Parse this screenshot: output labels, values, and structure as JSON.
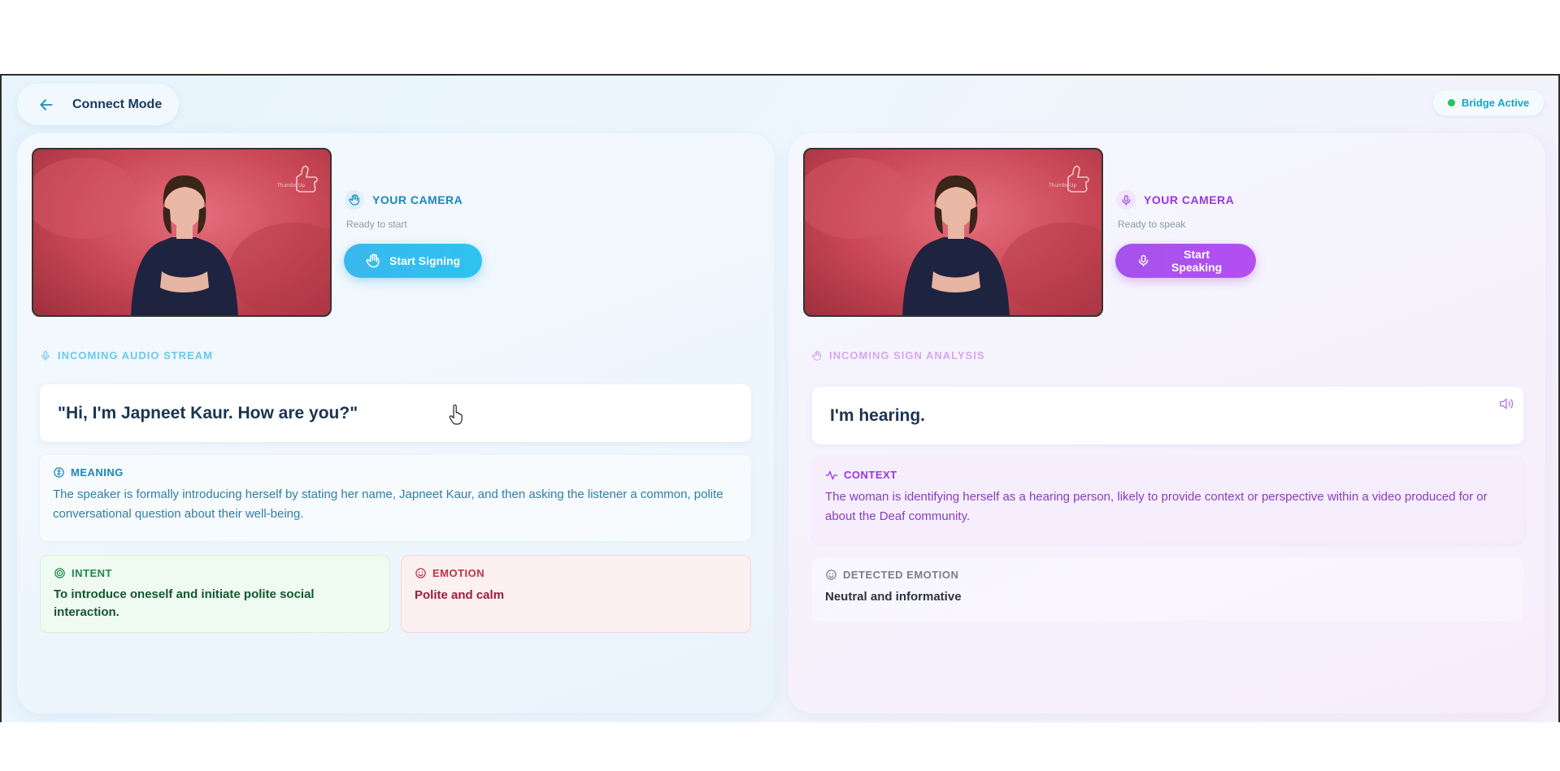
{
  "header": {
    "title": "Connect Mode",
    "status": "Bridge Active"
  },
  "left": {
    "camera_label": "YOUR CAMERA",
    "camera_status": "Ready to start",
    "button": "Start Signing",
    "stream_label": "INCOMING AUDIO STREAM",
    "quote": "\"Hi, I'm Japneet Kaur. How are you?\"",
    "meaning": {
      "label": "MEANING",
      "text": "The speaker is formally introducing herself by stating her name, Japneet Kaur, and then asking the listener a common, polite conversational question about their well-being."
    },
    "intent": {
      "label": "INTENT",
      "text": "To introduce oneself and initiate polite social interaction."
    },
    "emotion": {
      "label": "EMOTION",
      "text": "Polite and calm"
    }
  },
  "right": {
    "camera_label": "YOUR CAMERA",
    "camera_status": "Ready to speak",
    "button": "Start Speaking",
    "stream_label": "INCOMING SIGN ANALYSIS",
    "quote": "I'm hearing.",
    "context": {
      "label": "CONTEXT",
      "text": "The woman is identifying herself as a hearing person, likely to provide context or perspective within a video produced for or about the Deaf community."
    },
    "detected_emotion": {
      "label": "DETECTED EMOTION",
      "text": "Neutral and informative"
    }
  },
  "colors": {
    "accent_blue": "#2eb6ec",
    "accent_purple": "#a94ff0",
    "status_green": "#22c55e",
    "text_dark": "#1b3550"
  }
}
